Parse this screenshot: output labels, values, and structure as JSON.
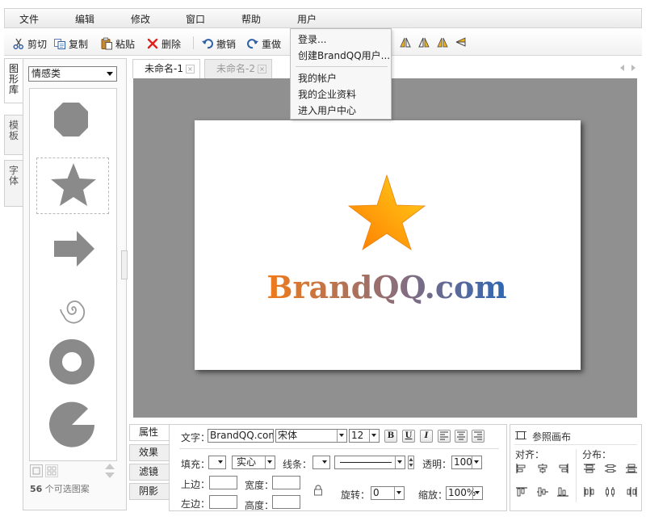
{
  "menubar": {
    "items": [
      "文件",
      "编辑",
      "修改",
      "窗口",
      "帮助",
      "用户"
    ]
  },
  "toolbar": {
    "cut": "剪切",
    "copy": "复制",
    "paste": "粘贴",
    "delete": "删除",
    "undo": "撤销",
    "redo": "重做"
  },
  "user_menu": {
    "items": [
      "登录...",
      "创建BrandQQ用户...",
      "我的帐户",
      "我的企业资料",
      "进入用户中心"
    ]
  },
  "side_tabs": [
    "图形库",
    "模板",
    "字体"
  ],
  "library": {
    "category": "情感类",
    "shapes": [
      "octagon-shape",
      "star-shape",
      "arrow-shape",
      "spiral-shape",
      "ring-shape",
      "pie-shape"
    ],
    "count": "56",
    "count_suffix": " 个可选图案"
  },
  "documents": {
    "tabs": [
      "未命名-1",
      "未命名-2"
    ],
    "active": 0
  },
  "artwork": {
    "logo_text": "BrandQQ.com",
    "gradient_start": "#f07a1a",
    "gradient_end": "#2f67b3",
    "star_color_start": "#ff7a00",
    "star_color_end": "#ffd21a"
  },
  "properties": {
    "tabs": [
      "属性",
      "效果",
      "滤镜",
      "阴影"
    ],
    "text_label": "文字：",
    "text_value": "BrandQQ.com",
    "font": "宋体",
    "font_size": "12",
    "style_buttons": [
      "B",
      "U",
      "I"
    ],
    "fill_label": "填充：",
    "fill_type": "实心",
    "stroke_label": "线条：",
    "opacity_label": "透明：",
    "opacity_value": "100",
    "top_label": "上边：",
    "width_label": "宽度：",
    "left_label": "左边：",
    "height_label": "高度：",
    "rotate_label": "旋转：",
    "rotate_value": "0",
    "scale_label": "缩放：",
    "scale_value": "100%"
  },
  "reference": {
    "title": "参照画布",
    "align_label": "对齐：",
    "distribute_label": "分布："
  }
}
